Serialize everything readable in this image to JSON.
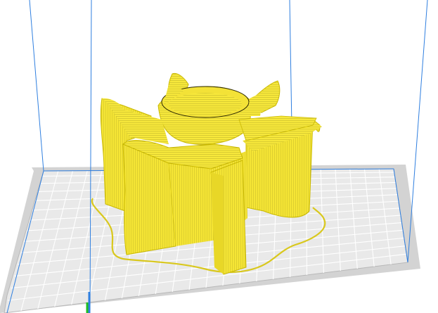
{
  "viewport": {
    "view": "slicer-layer-preview",
    "background": "#ffffff",
    "colors": {
      "build_volume_edges": "#2f7fe0",
      "plate": "#d6d6d6",
      "plate_grid": "#ffffff",
      "plate_border": "#b8b8b8",
      "model_fill": "#f7e83b",
      "model_shadow": "#c9b800",
      "toolpath_lines": "#2a2600",
      "skirt": "#d9c81d"
    },
    "icons": {
      "origin_axis": "origin-axis-icon"
    }
  }
}
